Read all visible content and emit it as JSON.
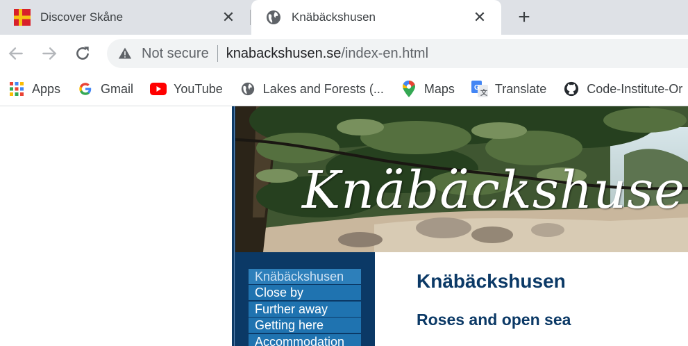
{
  "browser": {
    "tabs": [
      {
        "title": "Discover Skåne",
        "active": false,
        "favicon": "skane-flag-icon"
      },
      {
        "title": "Knäbäckshusen",
        "active": true,
        "favicon": "globe-icon"
      }
    ],
    "close_glyph": "✕",
    "new_tab_glyph": "+",
    "security_label": "Not secure",
    "url_domain": "knabackshusen.se",
    "url_path": "/index-en.html",
    "bookmarks": [
      {
        "label": "Apps",
        "icon": "apps-grid-icon"
      },
      {
        "label": "Gmail",
        "icon": "google-g-icon"
      },
      {
        "label": "YouTube",
        "icon": "youtube-icon"
      },
      {
        "label": "Lakes and Forests (...",
        "icon": "globe-icon"
      },
      {
        "label": "Maps",
        "icon": "maps-pin-icon"
      },
      {
        "label": "Translate",
        "icon": "translate-icon"
      },
      {
        "label": "Code-Institute-Or",
        "icon": "github-icon"
      }
    ],
    "colors": {
      "tabstrip": "#dee1e6",
      "omnibox": "#f1f3f4"
    }
  },
  "page": {
    "banner_title": "Knäbäckshusen",
    "menu": [
      {
        "label": "Knäbäckshusen",
        "current": true
      },
      {
        "label": "Close by",
        "current": false
      },
      {
        "label": "Further away",
        "current": false
      },
      {
        "label": "Getting here",
        "current": false
      },
      {
        "label": "Accommodation",
        "current": false
      }
    ],
    "heading": "Knäbäckshusen",
    "subheading": "Roses and open sea",
    "colors": {
      "navy": "#0b3966",
      "menu_item": "#1f73b0"
    }
  }
}
